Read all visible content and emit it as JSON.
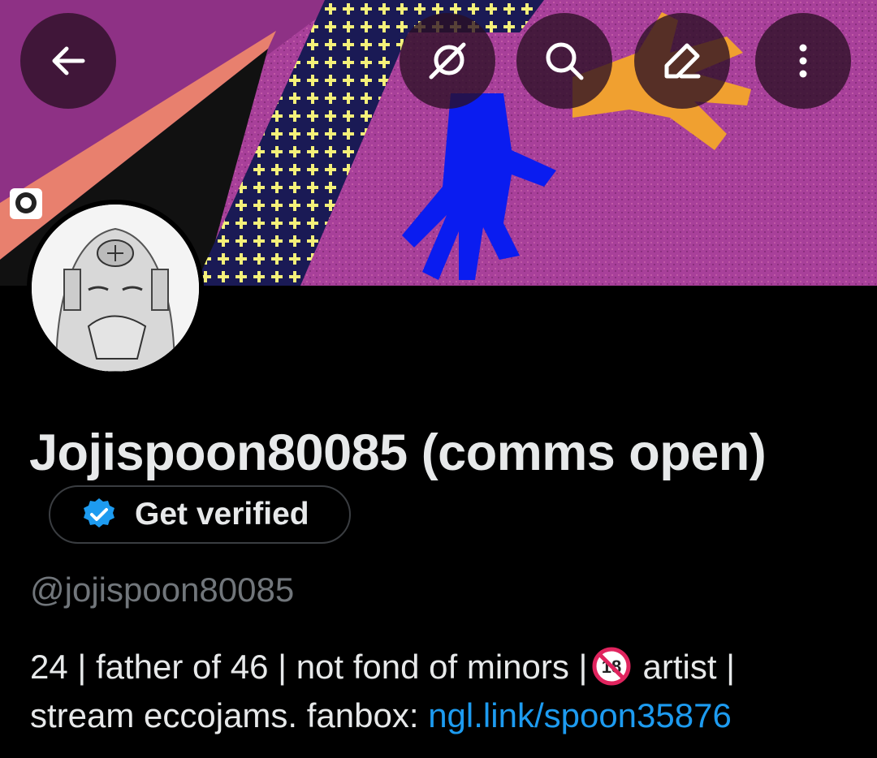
{
  "header": {
    "back_icon": "arrow-left-icon",
    "grok_icon": "grok-icon",
    "search_icon": "search-icon",
    "edit_icon": "edit-pencil-icon",
    "more_icon": "more-vertical-icon"
  },
  "profile": {
    "display_name": "Jojispoon80085 (comms open)",
    "verify_label": "Get verified",
    "handle": "@jojispoon80085",
    "bio_line1_a": "24 | father of 46 | not fond of minors |",
    "bio_line1_b": "artist |",
    "bio_line2_text": "stream eccojams. fanbox: ",
    "bio_link": "ngl.link/spoon35876",
    "no_minors_icon": "no-one-under-18-icon"
  },
  "colors": {
    "background": "#000000",
    "text": "#e7e9ea",
    "muted": "#71767b",
    "link": "#1d9bf0",
    "verified_badge": "#1d9bf0",
    "banner_purple": "#9a3a8c"
  }
}
